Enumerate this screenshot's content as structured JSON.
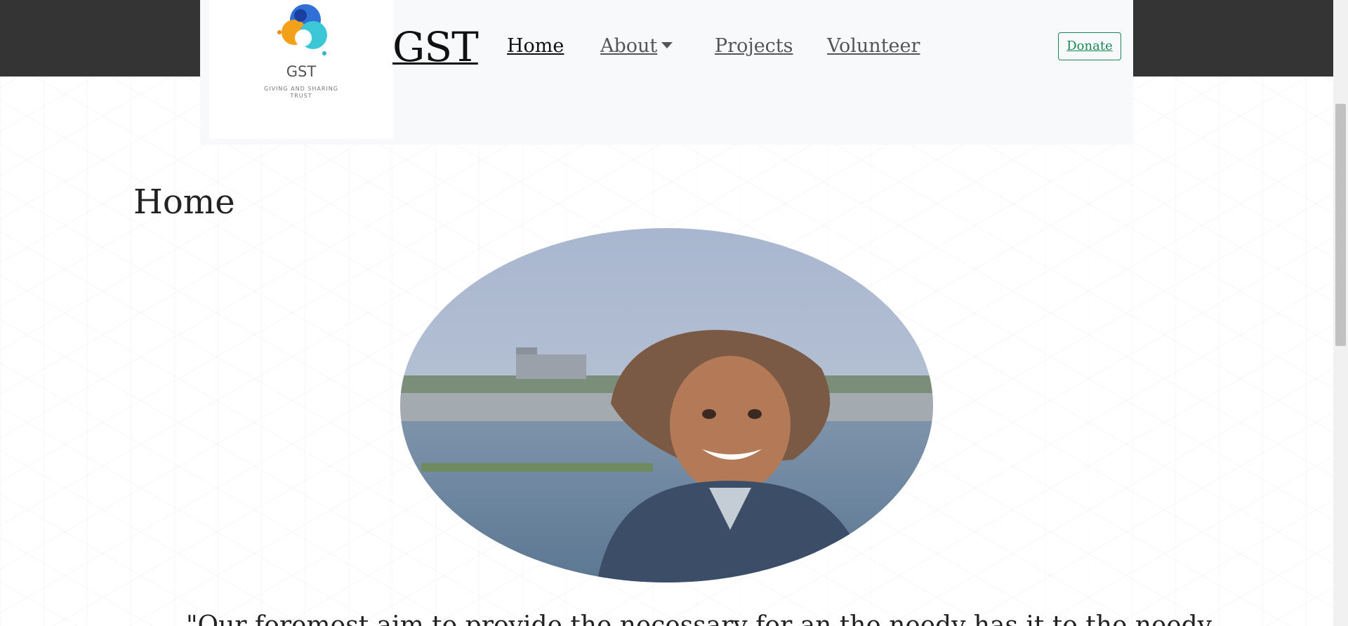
{
  "colors": {
    "topbar": "#343434",
    "navbar": "#f8f9fa",
    "donate": "#198754"
  },
  "logo": {
    "icon": "gst-logo-icon",
    "name": "GST",
    "tagline": "GIVING AND SHARING TRUST"
  },
  "brand": "GST",
  "nav": {
    "home": "Home",
    "about": "About",
    "projects": "Projects",
    "volunteer": "Volunteer",
    "donate": "Donate"
  },
  "page": {
    "title": "Home",
    "hero_alt": "Smiling child by a river",
    "quote_fragment": "\"Our foremost aim to provide the necessary for an the needy has it to the needy"
  }
}
